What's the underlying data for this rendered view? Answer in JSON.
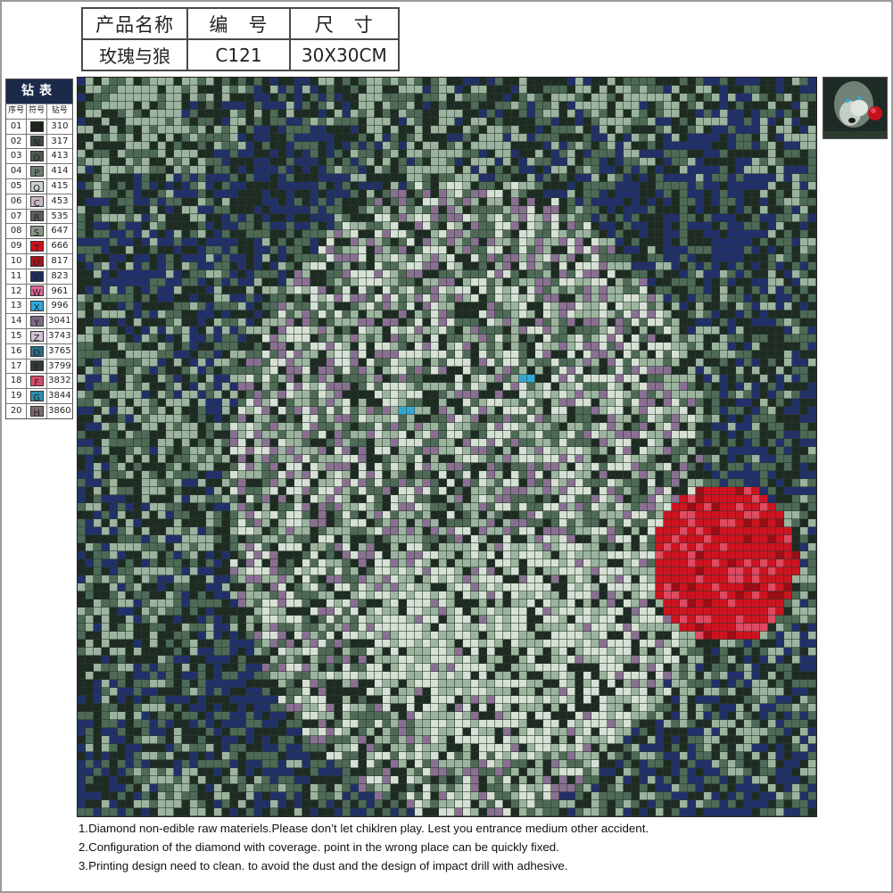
{
  "product": {
    "headers": [
      "产品名称",
      "编　号",
      "尺　寸"
    ],
    "values": [
      "玫瑰与狼",
      "C121",
      "30X30CM"
    ]
  },
  "legend": {
    "title": "钻表",
    "columns": [
      "序号",
      "符号",
      "钻号"
    ],
    "rows": [
      {
        "index": "01",
        "symbol": "M",
        "code": "310",
        "color": "#1a261c"
      },
      {
        "index": "02",
        "symbol": "N",
        "code": "317",
        "color": "#3d4a44"
      },
      {
        "index": "03",
        "symbol": "O",
        "code": "413",
        "color": "#4e5a52"
      },
      {
        "index": "04",
        "symbol": "P",
        "code": "414",
        "color": "#6f7c74"
      },
      {
        "index": "05",
        "symbol": "Q",
        "code": "415",
        "color": "#c9d4cc"
      },
      {
        "index": "06",
        "symbol": "C",
        "code": "453",
        "color": "#c8b7c3"
      },
      {
        "index": "07",
        "symbol": "R",
        "code": "535",
        "color": "#5b5f5c"
      },
      {
        "index": "08",
        "symbol": "S",
        "code": "647",
        "color": "#8a9688"
      },
      {
        "index": "09",
        "symbol": "T",
        "code": "666",
        "color": "#d0101a"
      },
      {
        "index": "10",
        "symbol": "U",
        "code": "817",
        "color": "#a8121c"
      },
      {
        "index": "11",
        "symbol": "V",
        "code": "823",
        "color": "#1f2d5e"
      },
      {
        "index": "12",
        "symbol": "W",
        "code": "961",
        "color": "#e0689c"
      },
      {
        "index": "13",
        "symbol": "X",
        "code": "996",
        "color": "#2fa8d8"
      },
      {
        "index": "14",
        "symbol": "Y",
        "code": "3041",
        "color": "#7d6a86"
      },
      {
        "index": "15",
        "symbol": "Z",
        "code": "3743",
        "color": "#cfc3d3"
      },
      {
        "index": "16",
        "symbol": "D",
        "code": "3765",
        "color": "#2a6d84"
      },
      {
        "index": "17",
        "symbol": "E",
        "code": "3799",
        "color": "#333836"
      },
      {
        "index": "18",
        "symbol": "F",
        "code": "3832",
        "color": "#d14c6a"
      },
      {
        "index": "19",
        "symbol": "G",
        "code": "3844",
        "color": "#2b8fb0"
      },
      {
        "index": "20",
        "symbol": "H",
        "code": "3860",
        "color": "#7a6c72"
      }
    ]
  },
  "notes": [
    "1.Diamond non-edible raw materiels.Please don’t let chiklren play. Lest you entrance medium other accident.",
    "2.Configuration of the diamond with coverage. point in the wrong place can be quickly fixed.",
    "3.Printing design need to clean. to avoid the dust and the design of impact drill with adhesive."
  ],
  "colors": {
    "legend_header_bg": "#1c2a4a",
    "mosaic_dark": "#1e2b22",
    "mosaic_mid": "#4e6a56",
    "mosaic_light": "#9cb49f",
    "mosaic_pale": "#d6e0d4",
    "mosaic_navy": "#22306a",
    "mosaic_violet": "#8a6f92",
    "rose_red": "#cc1420"
  }
}
